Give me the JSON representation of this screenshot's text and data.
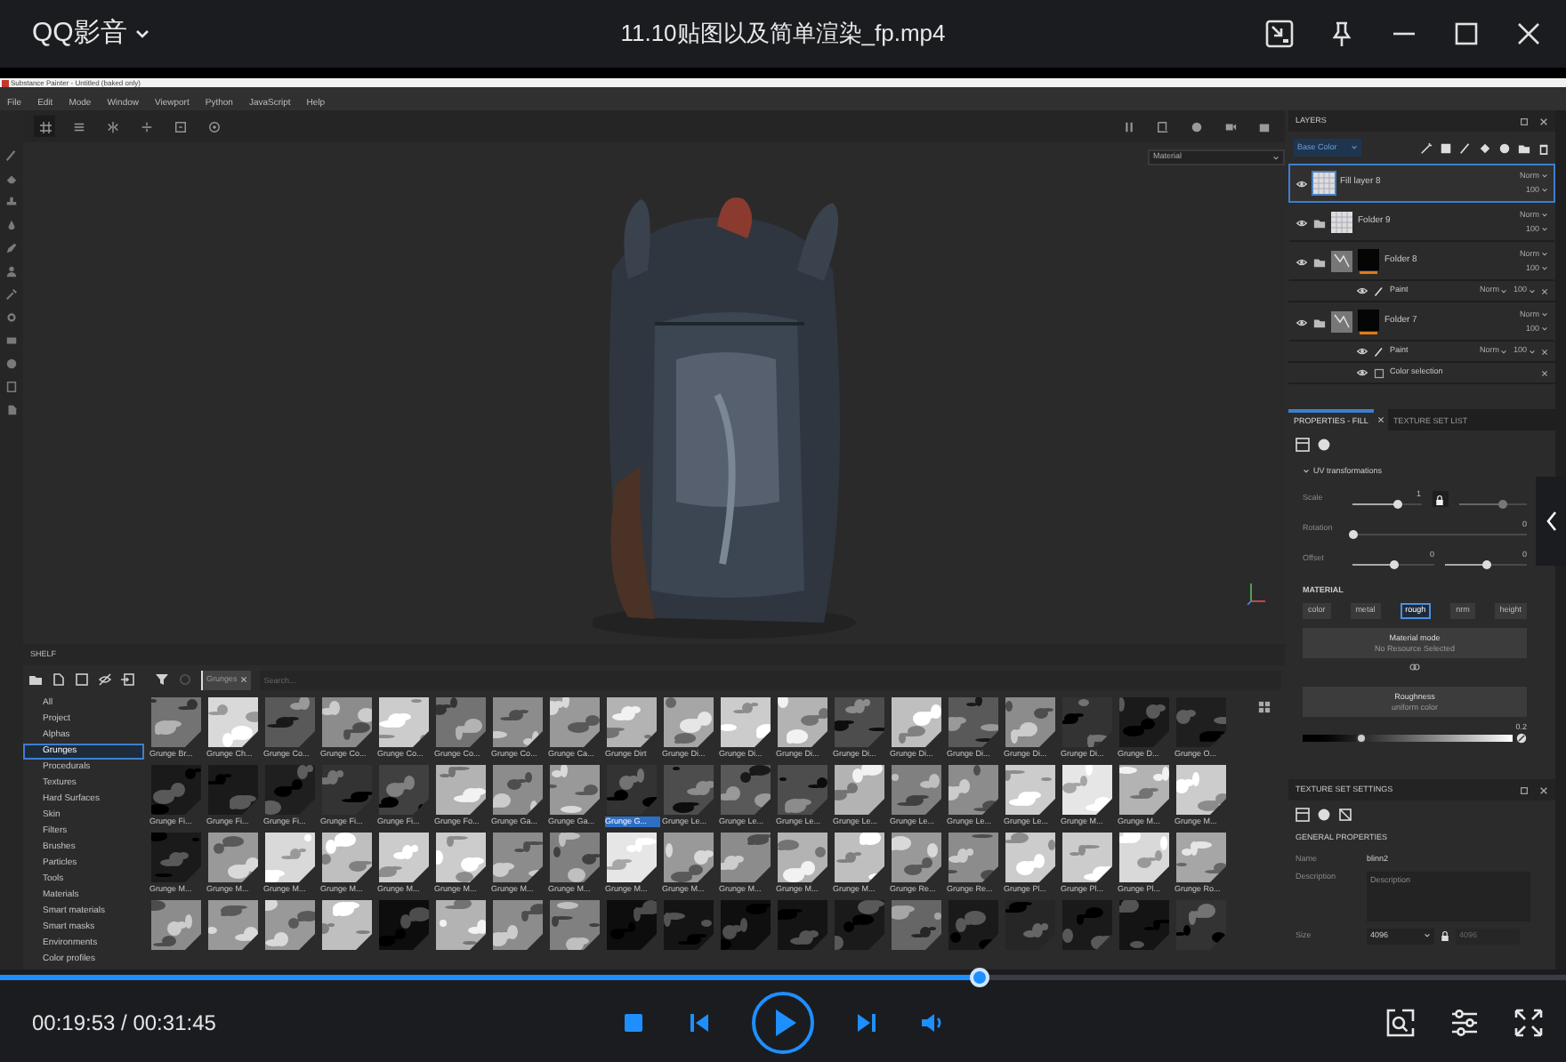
{
  "player": {
    "app_name": "QQ影音",
    "title": "11.10贴图以及简单渲染_fp.mp4",
    "progress": {
      "level": 0.626
    },
    "time": "00:19:53 / 00:31:45",
    "playing": false
  },
  "painter": {
    "window_title": "Substance Painter - Untitled (baked only)",
    "menu": [
      "File",
      "Edit",
      "Mode",
      "Window",
      "Viewport",
      "Python",
      "JavaScript",
      "Help"
    ],
    "viewport": {
      "channel": "Material"
    },
    "layers": {
      "title": "LAYERS",
      "channel": "Base Color",
      "items": [
        {
          "name": "Fill layer 8",
          "kind": "fill",
          "selected": true,
          "blend": "Norm",
          "opacity": "100",
          "mask": false
        },
        {
          "name": "Folder 9",
          "kind": "folder",
          "selected": false,
          "blend": "Norm",
          "opacity": "100",
          "mask": false
        },
        {
          "name": "Folder 8",
          "kind": "folder",
          "selected": false,
          "blend": "Norm",
          "opacity": "100",
          "mask": true,
          "children": [
            {
              "name": "Paint",
              "kind": "paint",
              "blend": "Norm",
              "opacity": "100"
            }
          ]
        },
        {
          "name": "Folder 7",
          "kind": "folder",
          "selected": false,
          "blend": "Norm",
          "opacity": "100",
          "mask": true,
          "children": [
            {
              "name": "Paint",
              "kind": "paint",
              "blend": "Norm",
              "opacity": "100"
            },
            {
              "name": "Color selection",
              "kind": "selection"
            }
          ]
        }
      ]
    },
    "properties": {
      "tabs": [
        {
          "label": "PROPERTIES - FILL",
          "selected": true
        },
        {
          "label": "TEXTURE SET LIST",
          "selected": false
        }
      ],
      "section": "UV transformations",
      "params": [
        {
          "label": "Scale",
          "kind": "locked_pair",
          "sliders": [
            {
              "value": "1",
              "level": 0.65
            },
            {
              "level": 0.65
            }
          ]
        },
        {
          "label": "Rotation",
          "kind": "single",
          "sliders": [
            {
              "value": "0",
              "level": 0.0
            }
          ]
        },
        {
          "label": "Offset",
          "kind": "pair",
          "sliders": [
            {
              "value": "0",
              "level": 0.5
            },
            {
              "value": "0",
              "level": 0.5
            }
          ]
        }
      ],
      "material_title": "MATERIAL",
      "channels": [
        {
          "label": "color",
          "selected": false
        },
        {
          "label": "metal",
          "selected": false
        },
        {
          "label": "rough",
          "selected": true
        },
        {
          "label": "nrm",
          "selected": false
        },
        {
          "label": "height",
          "selected": false
        }
      ],
      "material_mode": {
        "title": "Material mode",
        "value": "No Resource Selected"
      },
      "roughness": {
        "title": "Roughness",
        "value": "uniform color",
        "reading": "0.2",
        "level": 0.28
      }
    },
    "texture_set": {
      "title": "TEXTURE SET SETTINGS",
      "section": "GENERAL PROPERTIES",
      "name_label": "Name",
      "name": "blinn2",
      "description_label": "Description",
      "description_placeholder": "Description",
      "size_label": "Size",
      "size": "4096",
      "size_linked": "4096"
    },
    "shelf": {
      "title": "SHELF",
      "tag": "Grunges",
      "search_placeholder": "Search...",
      "categories": [
        {
          "label": "All",
          "selected": false
        },
        {
          "label": "Project",
          "selected": false
        },
        {
          "label": "Alphas",
          "selected": false
        },
        {
          "label": "Grunges",
          "selected": true
        },
        {
          "label": "Procedurals",
          "selected": false
        },
        {
          "label": "Textures",
          "selected": false
        },
        {
          "label": "Hard Surfaces",
          "selected": false
        },
        {
          "label": "Skin",
          "selected": false
        },
        {
          "label": "Filters",
          "selected": false
        },
        {
          "label": "Brushes",
          "selected": false
        },
        {
          "label": "Particles",
          "selected": false
        },
        {
          "label": "Tools",
          "selected": false
        },
        {
          "label": "Materials",
          "selected": false
        },
        {
          "label": "Smart materials",
          "selected": false
        },
        {
          "label": "Smart masks",
          "selected": false
        },
        {
          "label": "Environments",
          "selected": false
        },
        {
          "label": "Color profiles",
          "selected": false
        }
      ],
      "items": [
        {
          "label": "Grunge Br...",
          "selected": false
        },
        {
          "label": "Grunge Ch...",
          "selected": false
        },
        {
          "label": "Grunge Co...",
          "selected": false
        },
        {
          "label": "Grunge Co...",
          "selected": false
        },
        {
          "label": "Grunge Co...",
          "selected": false
        },
        {
          "label": "Grunge Co...",
          "selected": false
        },
        {
          "label": "Grunge Co...",
          "selected": false
        },
        {
          "label": "Grunge Ca...",
          "selected": false
        },
        {
          "label": "Grunge Dirt",
          "selected": false
        },
        {
          "label": "Grunge Di...",
          "selected": false
        },
        {
          "label": "Grunge Di...",
          "selected": false
        },
        {
          "label": "Grunge Di...",
          "selected": false
        },
        {
          "label": "Grunge Di...",
          "selected": false
        },
        {
          "label": "Grunge Di...",
          "selected": false
        },
        {
          "label": "Grunge Di...",
          "selected": false
        },
        {
          "label": "Grunge Di...",
          "selected": false
        },
        {
          "label": "Grunge Di...",
          "selected": false
        },
        {
          "label": "Grunge D...",
          "selected": false
        },
        {
          "label": "Grunge O...",
          "selected": false
        },
        {
          "label": "Grunge Fi...",
          "selected": false
        },
        {
          "label": "Grunge Fi...",
          "selected": false
        },
        {
          "label": "Grunge Fi...",
          "selected": false
        },
        {
          "label": "Grunge Fi...",
          "selected": false
        },
        {
          "label": "Grunge Fi...",
          "selected": false
        },
        {
          "label": "Grunge Fo...",
          "selected": false
        },
        {
          "label": "Grunge Ga...",
          "selected": false
        },
        {
          "label": "Grunge Ga...",
          "selected": false
        },
        {
          "label": "Grunge G...",
          "selected": true
        },
        {
          "label": "Grunge Le...",
          "selected": false
        },
        {
          "label": "Grunge Le...",
          "selected": false
        },
        {
          "label": "Grunge Le...",
          "selected": false
        },
        {
          "label": "Grunge Le...",
          "selected": false
        },
        {
          "label": "Grunge Le...",
          "selected": false
        },
        {
          "label": "Grunge Le...",
          "selected": false
        },
        {
          "label": "Grunge Le...",
          "selected": false
        },
        {
          "label": "Grunge M...",
          "selected": false
        },
        {
          "label": "Grunge M...",
          "selected": false
        },
        {
          "label": "Grunge M...",
          "selected": false
        },
        {
          "label": "Grunge M...",
          "selected": false
        },
        {
          "label": "Grunge M...",
          "selected": false
        },
        {
          "label": "Grunge M...",
          "selected": false
        },
        {
          "label": "Grunge M...",
          "selected": false
        },
        {
          "label": "Grunge M...",
          "selected": false
        },
        {
          "label": "Grunge M...",
          "selected": false
        },
        {
          "label": "Grunge M...",
          "selected": false
        },
        {
          "label": "Grunge M...",
          "selected": false
        },
        {
          "label": "Grunge M...",
          "selected": false
        },
        {
          "label": "Grunge M...",
          "selected": false
        },
        {
          "label": "Grunge M...",
          "selected": false
        },
        {
          "label": "Grunge M...",
          "selected": false
        },
        {
          "label": "Grunge M...",
          "selected": false
        },
        {
          "label": "Grunge Re...",
          "selected": false
        },
        {
          "label": "Grunge Re...",
          "selected": false
        },
        {
          "label": "Grunge Pl...",
          "selected": false
        },
        {
          "label": "Grunge Pl...",
          "selected": false
        },
        {
          "label": "Grunge Pl...",
          "selected": false
        },
        {
          "label": "Grunge Ro...",
          "selected": false
        },
        {
          "selected": false
        },
        {
          "selected": false
        },
        {
          "selected": false
        },
        {
          "selected": false
        },
        {
          "selected": false
        },
        {
          "selected": false
        },
        {
          "selected": false
        },
        {
          "selected": false
        },
        {
          "selected": false
        },
        {
          "selected": false
        },
        {
          "selected": false
        },
        {
          "selected": false
        },
        {
          "selected": false
        },
        {
          "selected": false
        },
        {
          "selected": false
        },
        {
          "selected": false
        },
        {
          "selected": false
        },
        {
          "selected": false
        },
        {
          "selected": false
        }
      ]
    }
  }
}
